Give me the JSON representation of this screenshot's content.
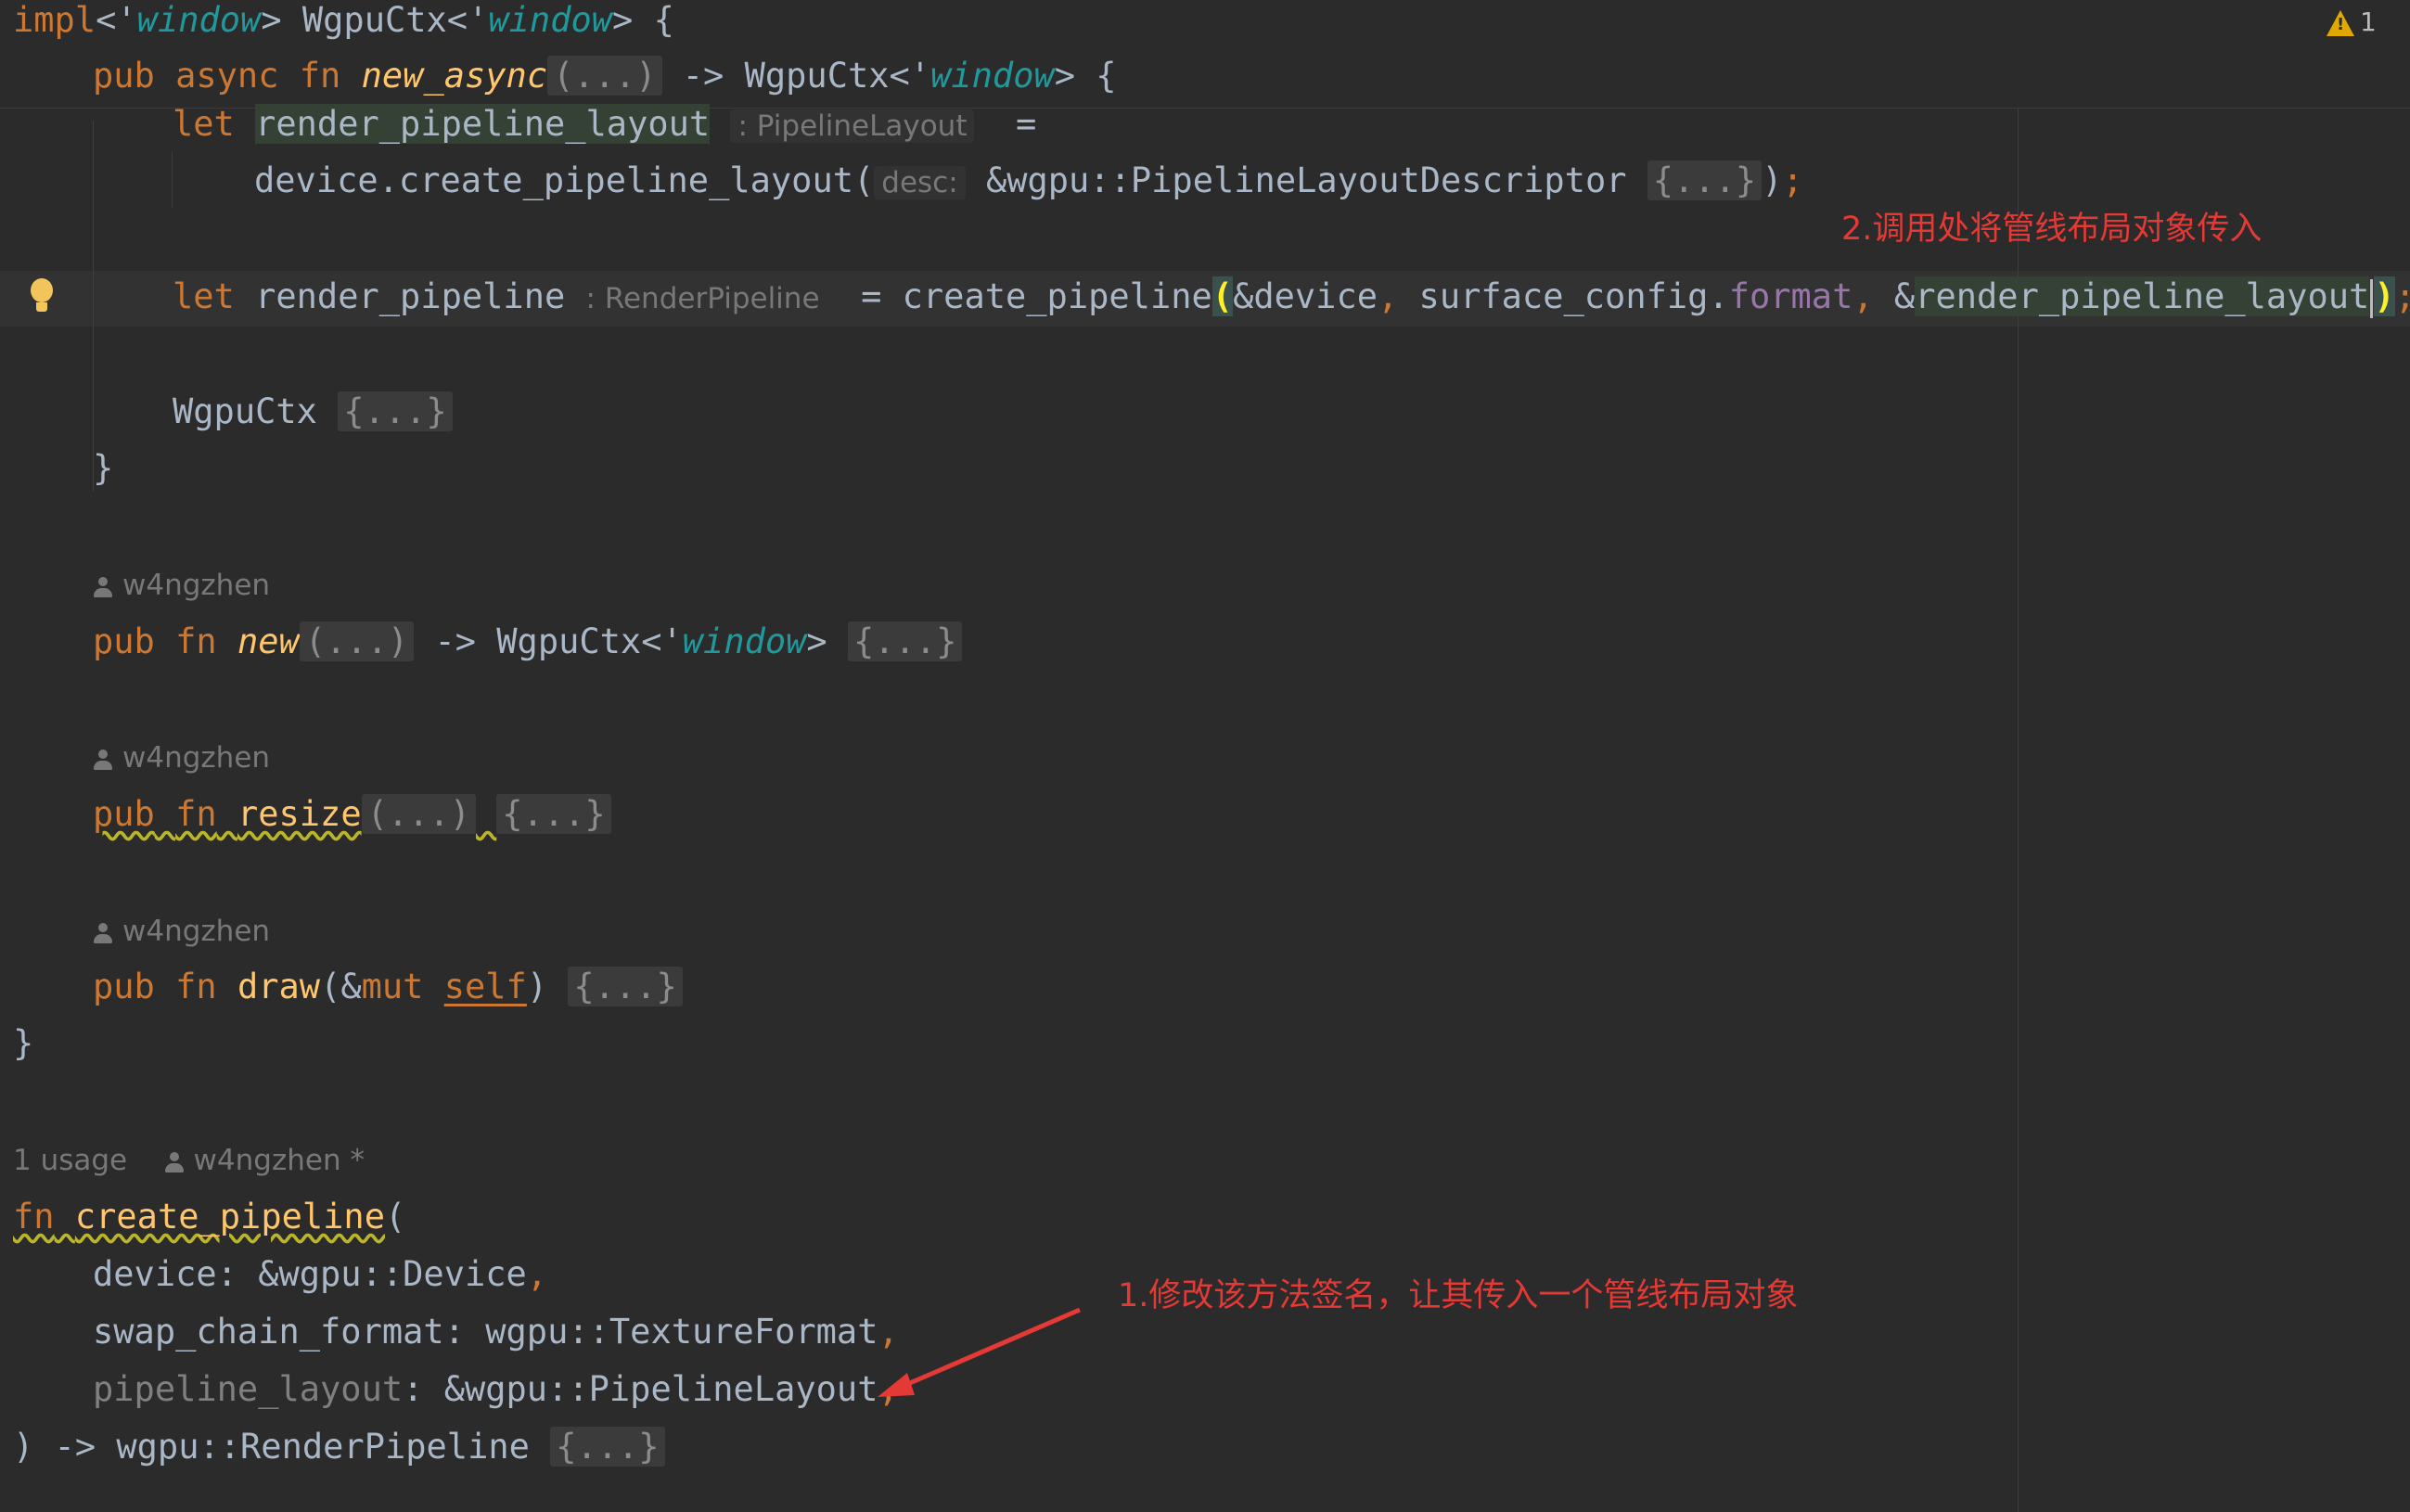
{
  "warnings": {
    "count": "1"
  },
  "code": {
    "impl_line": {
      "impl": "impl",
      "lt_open": "<'",
      "lt1": "window",
      "mid": "> WgpuCtx<'",
      "lt2": "window",
      "end": "> {"
    },
    "new_async_line": {
      "pub": "pub",
      "async": "async",
      "fn": "fn",
      "name": "new_async",
      "args": "(...)",
      "ret": " -> WgpuCtx<'",
      "lt": "window",
      "end": "> {"
    },
    "let_layout": {
      "let": "let",
      "var": "render_pipeline_layout",
      "hint": ": PipelineLayout",
      "eq": "="
    },
    "device_call": {
      "call": "device.create_pipeline_layout(",
      "hint": "desc:",
      "arg": "&wgpu::PipelineLayoutDescriptor",
      "fold": "{...}",
      "close": ")",
      "semi": ";"
    },
    "let_pipeline": {
      "let": "let",
      "var": "render_pipeline",
      "hint": ": RenderPipeline",
      "eq": "= create_pipeline",
      "paren_open": "(",
      "arg1": "&device",
      "comma1": ",",
      "arg2a": " surface_config.",
      "arg2b": "format",
      "comma2": ",",
      "arg3a": " &",
      "arg3b": "render_pipeline_layout",
      "paren_close": ")",
      "semi": ";"
    },
    "wgpuctx_line": {
      "name": "WgpuCtx",
      "fold": "{...}"
    },
    "close1": "}",
    "author1": "w4ngzhen",
    "new_line": {
      "pub": "pub",
      "fn": "fn",
      "name": "new",
      "args": "(...)",
      "ret": " -> WgpuCtx<'",
      "lt": "window",
      "gt": ">",
      "fold": "{...}"
    },
    "author2": "w4ngzhen",
    "resize_line": {
      "pub": "pub",
      "fn": "fn",
      "name": "resize",
      "args": "(...)",
      "fold": "{...}"
    },
    "author3": "w4ngzhen",
    "draw_line": {
      "pub": "pub",
      "fn": "fn",
      "name": "draw",
      "open": "(&",
      "mut": "mut",
      "self": "self",
      "close": ")",
      "fold": "{...}"
    },
    "close2": "}",
    "usage": "1 usage",
    "author4": "w4ngzhen *",
    "create_pipeline_line": {
      "fn": "fn",
      "name": "create_pipeline",
      "open": "("
    },
    "param1": {
      "name": "device: &wgpu::Device",
      "comma": ","
    },
    "param2": {
      "name": "swap_chain_format: wgpu::TextureFormat",
      "comma": ","
    },
    "param3": {
      "name": "pipeline_layout",
      "type": ": &wgpu::PipelineLayout",
      "comma": ","
    },
    "ret_line": {
      "text": ") -> wgpu::RenderPipeline",
      "fold": "{...}"
    }
  },
  "annotations": {
    "note1": "1.修改该方法签名，让其传入一个管线布局对象",
    "note2": "2.调用处将管线布局对象传入"
  },
  "colors": {
    "annotation": "#e53935",
    "keyword": "#cc7832",
    "function": "#ffc66d",
    "lifetime": "#20999d"
  }
}
